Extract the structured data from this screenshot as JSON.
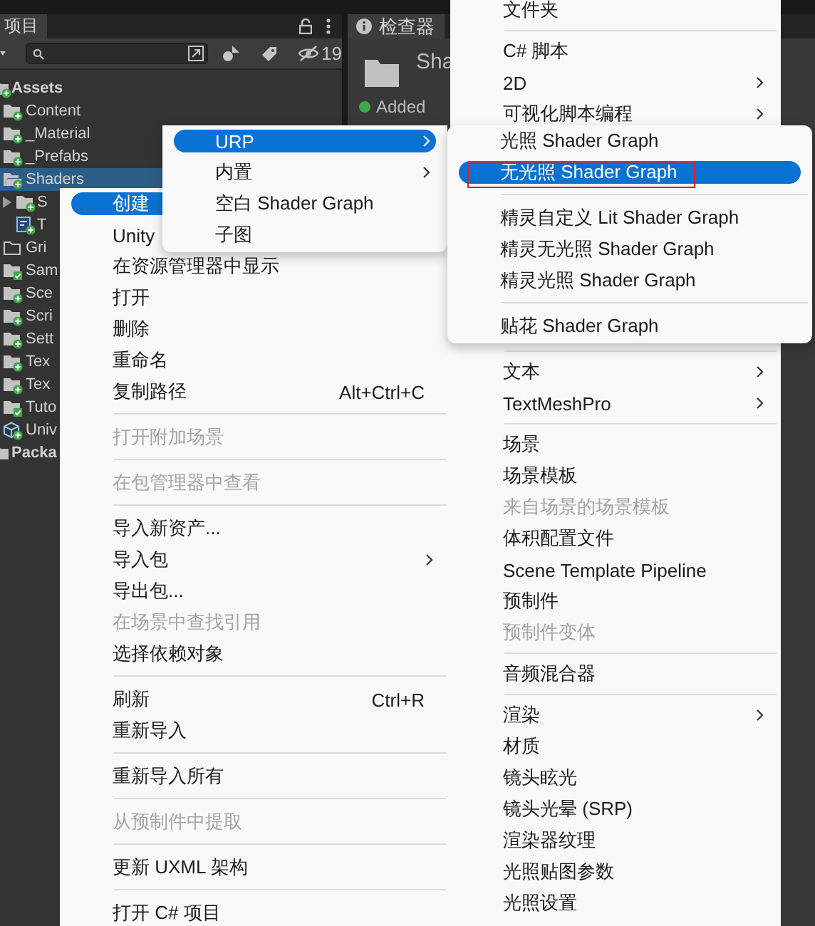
{
  "project_panel": {
    "tab": "项目",
    "hidden_count": "19",
    "tree": [
      {
        "label": "Assets",
        "kind": "folder",
        "selected": false,
        "children": [
          {
            "label": "Content",
            "kind": "folder",
            "selected": false
          },
          {
            "label": "_Material",
            "kind": "folder",
            "selected": false
          },
          {
            "label": "_Prefabs",
            "kind": "folder",
            "selected": false
          },
          {
            "label": "Shaders",
            "kind": "openfolder",
            "selected": true,
            "children": [
              {
                "label": "S",
                "kind": "folder",
                "selected": false,
                "expanded": false
              },
              {
                "label": "T",
                "kind": "shader",
                "selected": false
              }
            ]
          },
          {
            "label": "Gri",
            "kind": "emptyfolder",
            "selected": false
          },
          {
            "label": "Sam",
            "kind": "checkedfolder",
            "selected": false
          },
          {
            "label": "Sce",
            "kind": "folder",
            "selected": false
          },
          {
            "label": "Scri",
            "kind": "folder",
            "selected": false
          },
          {
            "label": "Sett",
            "kind": "folder",
            "selected": false
          },
          {
            "label": "Tex",
            "kind": "folder",
            "selected": false
          },
          {
            "label": "Tex",
            "kind": "folder",
            "selected": false
          },
          {
            "label": "Tuto",
            "kind": "checkedfolder",
            "selected": false
          },
          {
            "label": "Univ",
            "kind": "package",
            "selected": false
          }
        ]
      },
      {
        "label": "Packa",
        "kind": "plainfolder",
        "selected": false
      }
    ]
  },
  "inspector": {
    "tab": "检查器",
    "title": "Sha",
    "status": "Added"
  },
  "context_menu": {
    "items": [
      {
        "kind": "item",
        "label": "创建",
        "selected": true,
        "disabled": false
      },
      {
        "kind": "item",
        "label": "Unity",
        "selected": false,
        "disabled": false
      },
      {
        "kind": "item",
        "label": "在资源管理器中显示",
        "selected": false,
        "disabled": false
      },
      {
        "kind": "item",
        "label": "打开",
        "selected": false,
        "disabled": false
      },
      {
        "kind": "item",
        "label": "删除",
        "selected": false,
        "disabled": false
      },
      {
        "kind": "item",
        "label": "重命名",
        "selected": false,
        "disabled": false
      },
      {
        "kind": "item",
        "label": "复制路径",
        "shortcut": "Alt+Ctrl+C",
        "selected": false,
        "disabled": false
      },
      {
        "kind": "separator"
      },
      {
        "kind": "item",
        "label": "打开附加场景",
        "selected": false,
        "disabled": true
      },
      {
        "kind": "separator"
      },
      {
        "kind": "item",
        "label": "在包管理器中查看",
        "selected": false,
        "disabled": true
      },
      {
        "kind": "separator"
      },
      {
        "kind": "item",
        "label": "导入新资产...",
        "selected": false,
        "disabled": false
      },
      {
        "kind": "item",
        "label": "导入包",
        "selected": false,
        "disabled": false,
        "submenu": true
      },
      {
        "kind": "item",
        "label": "导出包...",
        "selected": false,
        "disabled": false
      },
      {
        "kind": "item",
        "label": "在场景中查找引用",
        "selected": false,
        "disabled": true
      },
      {
        "kind": "item",
        "label": "选择依赖对象",
        "selected": false,
        "disabled": false
      },
      {
        "kind": "separator"
      },
      {
        "kind": "item",
        "label": "刷新",
        "shortcut": "Ctrl+R",
        "selected": false,
        "disabled": false
      },
      {
        "kind": "item",
        "label": "重新导入",
        "selected": false,
        "disabled": false
      },
      {
        "kind": "separator"
      },
      {
        "kind": "item",
        "label": "重新导入所有",
        "selected": false,
        "disabled": false
      },
      {
        "kind": "separator"
      },
      {
        "kind": "item",
        "label": "从预制件中提取",
        "selected": false,
        "disabled": true
      },
      {
        "kind": "separator"
      },
      {
        "kind": "item",
        "label": "更新 UXML 架构",
        "selected": false,
        "disabled": false
      },
      {
        "kind": "separator"
      },
      {
        "kind": "item",
        "label": "打开 C# 项目",
        "selected": false,
        "disabled": false
      }
    ]
  },
  "create_menu": {
    "items_top": [
      {
        "kind": "item",
        "label": "文件夹",
        "selected": false,
        "disabled": false
      },
      {
        "kind": "separator"
      },
      {
        "kind": "item",
        "label": "C# 脚本",
        "selected": false,
        "disabled": false
      },
      {
        "kind": "item",
        "label": "2D",
        "selected": false,
        "disabled": false,
        "submenu": true
      },
      {
        "kind": "item",
        "label": "可视化脚本编程",
        "selected": false,
        "disabled": false,
        "submenu": true
      }
    ],
    "items_bottom": [
      {
        "kind": "separator"
      },
      {
        "kind": "item",
        "label": "文本",
        "selected": false,
        "disabled": false,
        "submenu": true
      },
      {
        "kind": "item",
        "label": "TextMeshPro",
        "selected": false,
        "disabled": false,
        "submenu": true
      },
      {
        "kind": "separator"
      },
      {
        "kind": "item",
        "label": "场景",
        "selected": false,
        "disabled": false
      },
      {
        "kind": "item",
        "label": "场景模板",
        "selected": false,
        "disabled": false
      },
      {
        "kind": "item",
        "label": "来自场景的场景模板",
        "selected": false,
        "disabled": true
      },
      {
        "kind": "item",
        "label": "体积配置文件",
        "selected": false,
        "disabled": false
      },
      {
        "kind": "item",
        "label": "Scene Template Pipeline",
        "selected": false,
        "disabled": false
      },
      {
        "kind": "item",
        "label": "预制件",
        "selected": false,
        "disabled": false
      },
      {
        "kind": "item",
        "label": "预制件变体",
        "selected": false,
        "disabled": true
      },
      {
        "kind": "separator"
      },
      {
        "kind": "item",
        "label": "音频混合器",
        "selected": false,
        "disabled": false
      },
      {
        "kind": "separator"
      },
      {
        "kind": "item",
        "label": "渲染",
        "selected": false,
        "disabled": false,
        "submenu": true
      },
      {
        "kind": "item",
        "label": "材质",
        "selected": false,
        "disabled": false
      },
      {
        "kind": "item",
        "label": "镜头眩光",
        "selected": false,
        "disabled": false
      },
      {
        "kind": "item",
        "label": "镜头光晕 (SRP)",
        "selected": false,
        "disabled": false
      },
      {
        "kind": "item",
        "label": "渲染器纹理",
        "selected": false,
        "disabled": false
      },
      {
        "kind": "item",
        "label": "光照贴图参数",
        "selected": false,
        "disabled": false
      },
      {
        "kind": "item",
        "label": "光照设置",
        "selected": false,
        "disabled": false
      }
    ]
  },
  "shader_graph_menu": {
    "items": [
      {
        "kind": "item",
        "label": "URP",
        "selected": true,
        "disabled": false,
        "submenu": true
      },
      {
        "kind": "item",
        "label": "内置",
        "selected": false,
        "disabled": false,
        "submenu": true
      },
      {
        "kind": "item",
        "label": "空白 Shader Graph",
        "selected": false,
        "disabled": false
      },
      {
        "kind": "item",
        "label": "子图",
        "selected": false,
        "disabled": false
      }
    ]
  },
  "urp_menu": {
    "items": [
      {
        "kind": "item",
        "label": "光照 Shader Graph",
        "selected": false,
        "disabled": false
      },
      {
        "kind": "item",
        "label": "无光照 Shader Graph",
        "selected": true,
        "disabled": false,
        "annotated": true
      },
      {
        "kind": "separator"
      },
      {
        "kind": "item",
        "label": "精灵自定义 Lit Shader Graph",
        "selected": false,
        "disabled": false
      },
      {
        "kind": "item",
        "label": "精灵无光照 Shader Graph",
        "selected": false,
        "disabled": false
      },
      {
        "kind": "item",
        "label": "精灵光照 Shader Graph",
        "selected": false,
        "disabled": false
      },
      {
        "kind": "separator"
      },
      {
        "kind": "item",
        "label": "贴花 Shader Graph",
        "selected": false,
        "disabled": false
      }
    ]
  }
}
